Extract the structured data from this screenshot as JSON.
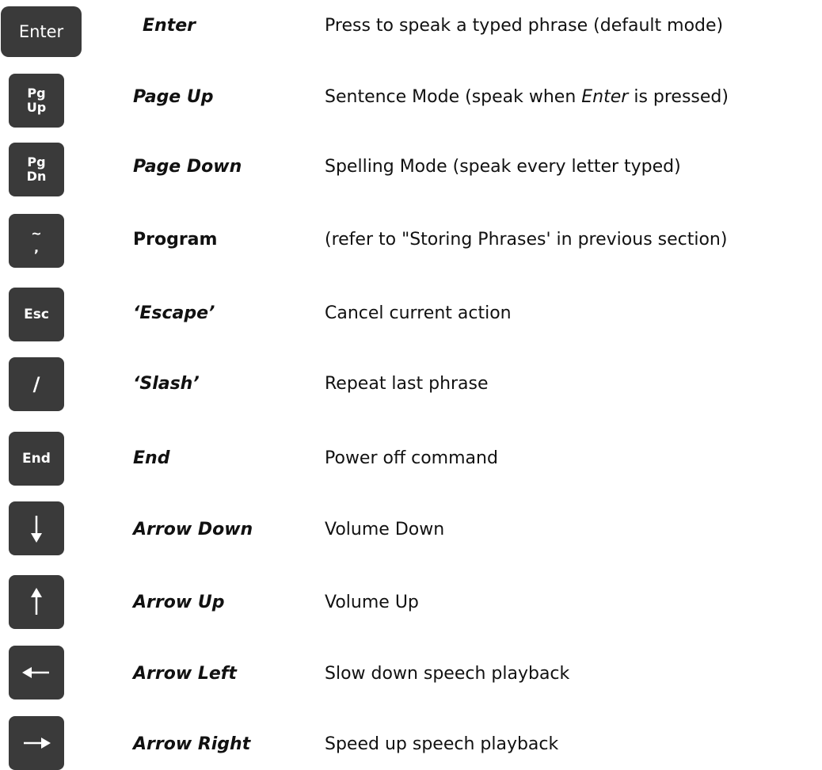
{
  "rows": [
    {
      "key_label": "Enter",
      "name": "Enter",
      "desc": "Press to speak a typed phrase  (default mode)"
    },
    {
      "key_label": [
        "Pg",
        "Up"
      ],
      "name": "Page Up",
      "desc_before": "Sentence Mode (speak when ",
      "desc_em": "Enter",
      "desc_after": " is pressed)"
    },
    {
      "key_label": [
        "Pg",
        "Dn"
      ],
      "name": "Page Down",
      "desc": "Spelling Mode (speak every letter typed)"
    },
    {
      "key_label": [
        "~",
        ","
      ],
      "name": "Program",
      "desc": "(refer to \"Storing Phrases' in previous section)"
    },
    {
      "key_label": "Esc",
      "name": "‘Escape’",
      "desc": "Cancel current action"
    },
    {
      "key_label": "/",
      "name": "‘Slash’",
      "desc": "Repeat last phrase"
    },
    {
      "key_label": "End",
      "name": "End",
      "desc": "Power off command"
    },
    {
      "key_icon": "arrow-down-icon",
      "name": "Arrow Down",
      "desc": "Volume Down"
    },
    {
      "key_icon": "arrow-up-icon",
      "name": "Arrow Up",
      "desc": "Volume Up"
    },
    {
      "key_icon": "arrow-left-icon",
      "name": "Arrow Left",
      "desc": "Slow down speech playback"
    },
    {
      "key_icon": "arrow-right-icon",
      "name": "Arrow Right",
      "desc": "Speed up speech playback"
    }
  ],
  "colors": {
    "key_bg": "#3a3a3a",
    "key_fg": "#ffffff",
    "text": "#111111",
    "background": "#ffffff"
  }
}
